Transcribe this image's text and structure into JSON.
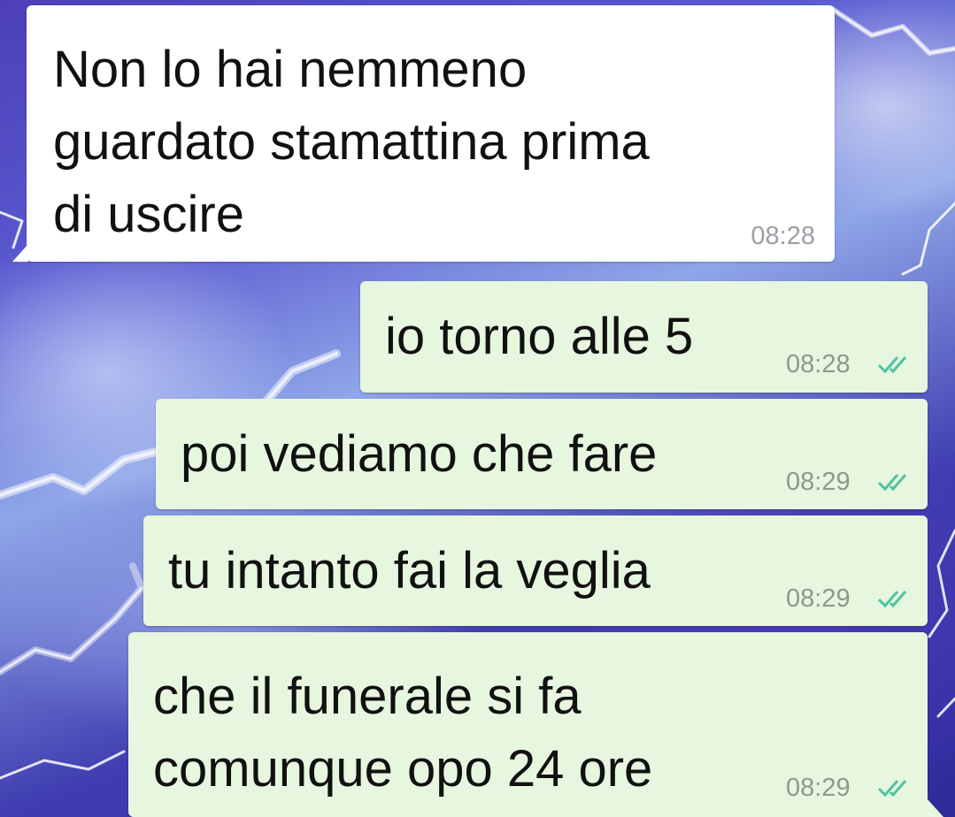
{
  "chat": {
    "messages": [
      {
        "direction": "incoming",
        "text_lines": [
          "Non lo hai nemmeno",
          "guardato stamattina prima",
          "di uscire"
        ],
        "time": "08:28",
        "status": ""
      },
      {
        "direction": "outgoing",
        "text_lines": [
          "io torno alle 5"
        ],
        "time": "08:28",
        "status": "read"
      },
      {
        "direction": "outgoing",
        "text_lines": [
          "poi vediamo che fare"
        ],
        "time": "08:29",
        "status": "read"
      },
      {
        "direction": "outgoing",
        "text_lines": [
          "tu intanto fai la veglia"
        ],
        "time": "08:29",
        "status": "read"
      },
      {
        "direction": "outgoing",
        "text_lines": [
          "che il funerale si fa",
          "comunque opo 24 ore"
        ],
        "time": "08:29",
        "status": "read"
      }
    ]
  },
  "colors": {
    "incoming_bubble": "#ffffff",
    "outgoing_bubble": "#e7f6df",
    "read_ticks": "#4fc3a1",
    "timestamp": "#8c9a8c"
  },
  "icons": {
    "status_read": "double-check-icon"
  }
}
